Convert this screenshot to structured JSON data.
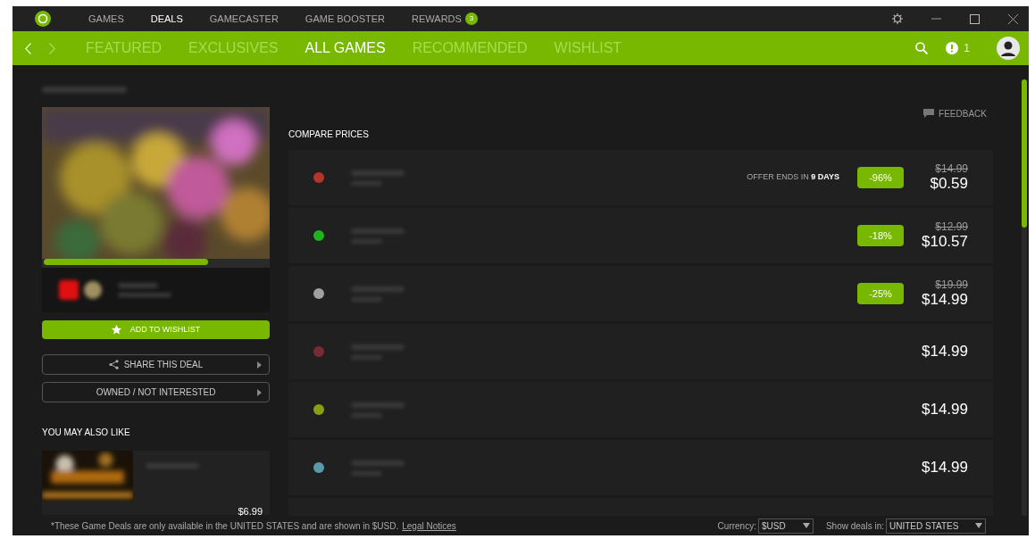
{
  "top_nav": {
    "items": [
      {
        "label": "GAMES",
        "selected": false
      },
      {
        "label": "DEALS",
        "selected": true
      },
      {
        "label": "GAMECASTER",
        "selected": false
      },
      {
        "label": "GAME BOOSTER",
        "selected": false
      },
      {
        "label": "REWARDS",
        "selected": false,
        "badge": "3"
      }
    ]
  },
  "sub_nav": {
    "items": [
      {
        "label": "FEATURED",
        "selected": false
      },
      {
        "label": "EXCLUSIVES",
        "selected": false
      },
      {
        "label": "ALL GAMES",
        "selected": true
      },
      {
        "label": "RECOMMENDED",
        "selected": false
      },
      {
        "label": "WISHLIST",
        "selected": false
      }
    ],
    "alert_count": "1"
  },
  "media_progress": {
    "level": 0.72
  },
  "actions": [
    {
      "kind": "wishlist",
      "label": "ADD TO WISHLIST"
    },
    {
      "kind": "share",
      "label": "SHARE THIS DEAL"
    },
    {
      "kind": "plain",
      "label": "OWNED / NOT INTERESTED"
    }
  ],
  "also_like": {
    "title": "YOU MAY ALSO LIKE",
    "items": [
      {
        "price": "$6.99"
      }
    ]
  },
  "feedback": "FEEDBACK",
  "compare_title": "COMPARE PRICES",
  "offers": [
    {
      "color": "#b5352a",
      "note": "OFFER ENDS IN **9 DAYS**",
      "discount": "-96%",
      "original_price": "$14.99",
      "price": "$0.59"
    },
    {
      "color": "#1fb41f",
      "discount": "-18%",
      "original_price": "$12.99",
      "price": "$10.57"
    },
    {
      "color": "#a0a0a0",
      "discount": "-25%",
      "original_price": "$19.99",
      "price": "$14.99"
    },
    {
      "color": "#7a2a35",
      "price": "$14.99"
    },
    {
      "color": "#8aa010",
      "price": "$14.99"
    },
    {
      "color": "#5a9aa8",
      "price": "$14.99"
    }
  ],
  "footer": {
    "notice": "*These Game Deals are only available in the UNITED STATES and are shown in $USD.",
    "link": "Legal Notices",
    "currency_label": "Currency:",
    "currency": "$USD",
    "region_label": "Show deals in:",
    "region": "UNITED STATES"
  }
}
